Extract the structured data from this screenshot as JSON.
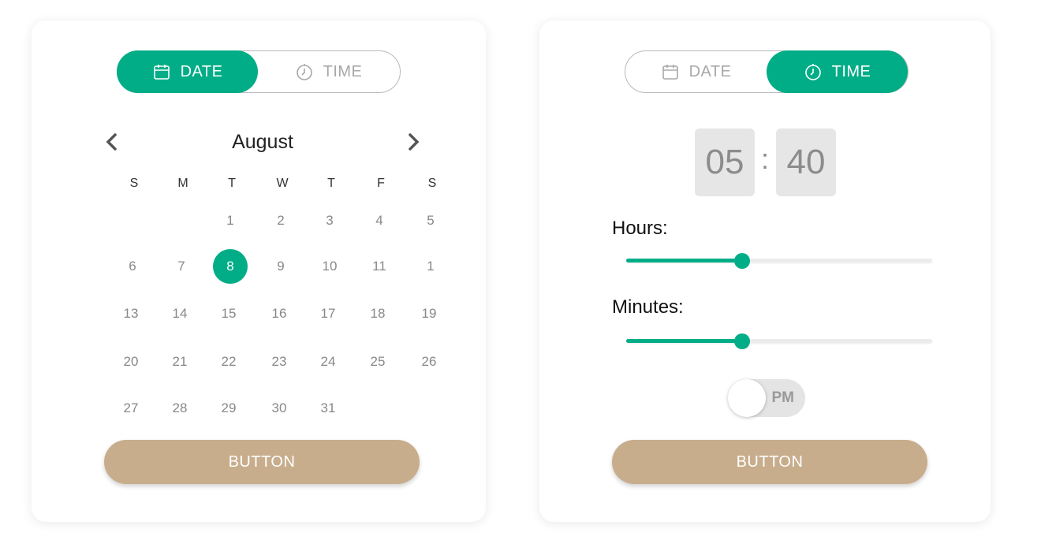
{
  "colors": {
    "accent": "#00ad87",
    "button": "#c8ad8c",
    "muted": "#a8a8a8"
  },
  "date_card": {
    "tabs": [
      {
        "label": "DATE",
        "icon": "calendar-icon",
        "active": true
      },
      {
        "label": "TIME",
        "icon": "clock-icon",
        "active": false
      }
    ],
    "month": "August",
    "weekdays": [
      "S",
      "M",
      "T",
      "W",
      "T",
      "F",
      "S"
    ],
    "weeks": [
      [
        "",
        "",
        "1",
        "2",
        "3",
        "4",
        "5"
      ],
      [
        "6",
        "7",
        "8",
        "9",
        "10",
        "11",
        "1"
      ],
      [
        "13",
        "14",
        "15",
        "16",
        "17",
        "18",
        "19"
      ],
      [
        "20",
        "21",
        "22",
        "23",
        "24",
        "25",
        "26"
      ],
      [
        "27",
        "28",
        "29",
        "30",
        "31",
        "",
        ""
      ]
    ],
    "selected_day": "8",
    "button_label": "BUTTON"
  },
  "time_card": {
    "tabs": [
      {
        "label": "DATE",
        "icon": "calendar-icon",
        "active": false
      },
      {
        "label": "TIME",
        "icon": "clock-icon",
        "active": true
      }
    ],
    "hours": "05",
    "separator": ":",
    "minutes": "40",
    "hours_label": "Hours:",
    "minutes_label": "Minutes:",
    "hours_slider_value": 0.38,
    "minutes_slider_value": 0.38,
    "ampm_label": "PM",
    "button_label": "BUTTON"
  }
}
